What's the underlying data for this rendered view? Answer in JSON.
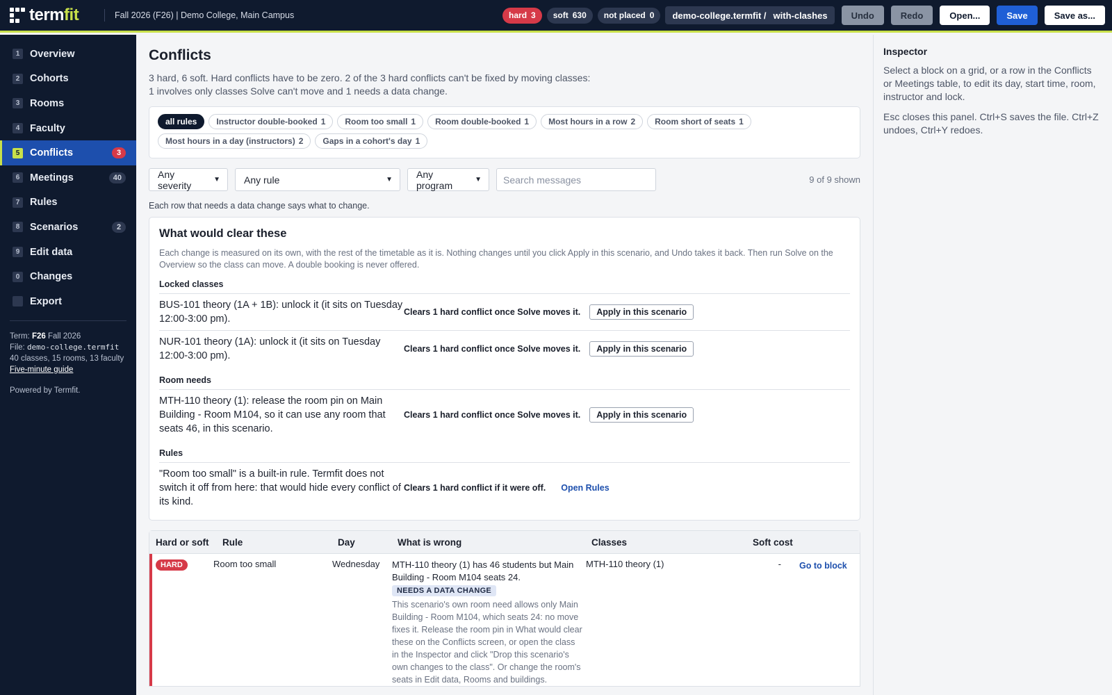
{
  "app": {
    "brand_a": "term",
    "brand_b": "fit",
    "term_label": "Fall 2026 (F26) | Demo College, Main Campus",
    "pills": {
      "hard_label": "hard",
      "hard_value": "3",
      "soft_label": "soft",
      "soft_value": "630",
      "unplaced_label": "not placed",
      "unplaced_value": "0"
    },
    "file_chip": {
      "file": "demo-college.termfit /",
      "scenario": "with-clashes"
    },
    "buttons": {
      "undo": "Undo",
      "redo": "Redo",
      "open": "Open...",
      "save": "Save",
      "save_as": "Save as..."
    }
  },
  "sidebar": {
    "items": [
      {
        "key": "1",
        "label": "Overview",
        "badge": ""
      },
      {
        "key": "2",
        "label": "Cohorts",
        "badge": ""
      },
      {
        "key": "3",
        "label": "Rooms",
        "badge": ""
      },
      {
        "key": "4",
        "label": "Faculty",
        "badge": ""
      },
      {
        "key": "5",
        "label": "Conflicts",
        "badge": "3"
      },
      {
        "key": "6",
        "label": "Meetings",
        "badge": "40"
      },
      {
        "key": "7",
        "label": "Rules",
        "badge": ""
      },
      {
        "key": "8",
        "label": "Scenarios",
        "badge": "2"
      },
      {
        "key": "9",
        "label": "Edit data",
        "badge": ""
      },
      {
        "key": "0",
        "label": "Changes",
        "badge": ""
      },
      {
        "key": "",
        "label": "Export",
        "badge": ""
      }
    ],
    "meta": {
      "term_prefix": "Term:",
      "term_code": "F26",
      "term_name": "Fall 2026",
      "file_prefix": "File:",
      "file_name": "demo-college.termfit",
      "counts": "40 classes, 15 rooms, 13 faculty",
      "guide_link": "Five-minute guide",
      "powered": "Powered by Termfit."
    }
  },
  "main": {
    "title": "Conflicts",
    "summary_line1": "3 hard, 6 soft. Hard conflicts have to be zero. 2 of the 3 hard conflicts can't be fixed by moving classes:",
    "summary_line2": "1 involves only classes Solve can't move and 1 needs a data change.",
    "rule_chips": [
      {
        "label": "all rules",
        "count": ""
      },
      {
        "label": "Instructor double-booked",
        "count": "1"
      },
      {
        "label": "Room too small",
        "count": "1"
      },
      {
        "label": "Room double-booked",
        "count": "1"
      },
      {
        "label": "Most hours in a row",
        "count": "2"
      },
      {
        "label": "Room short of seats",
        "count": "1"
      },
      {
        "label": "Most hours in a day (instructors)",
        "count": "2"
      },
      {
        "label": "Gaps in a cohort's day",
        "count": "1"
      }
    ],
    "filters": {
      "severity": "Any severity",
      "rule": "Any rule",
      "program": "Any program",
      "search_placeholder": "Search messages",
      "shown": "9 of 9 shown"
    },
    "hint": "Each row that needs a data change says what to change.",
    "clear_card": {
      "title": "What would clear these",
      "desc": "Each change is measured on its own, with the rest of the timetable as it is. Nothing changes until you click Apply in this scenario, and Undo takes it back. Then run Solve on the Overview so the class can move. A double booking is never offered.",
      "groups": [
        {
          "heading": "Locked classes",
          "rows": [
            {
              "text": "BUS-101 theory (1A + 1B): unlock it (it sits on Tuesday 12:00-3:00 pm).",
              "effect": "Clears 1 hard conflict once Solve moves it.",
              "action": "Apply in this scenario"
            },
            {
              "text": "NUR-101 theory (1A): unlock it (it sits on Tuesday 12:00-3:00 pm).",
              "effect": "Clears 1 hard conflict once Solve moves it.",
              "action": "Apply in this scenario"
            }
          ]
        },
        {
          "heading": "Room needs",
          "rows": [
            {
              "text": "MTH-110 theory (1): release the room pin on Main Building - Room M104, so it can use any room that seats 46, in this scenario.",
              "effect": "Clears 1 hard conflict once Solve moves it.",
              "action": "Apply in this scenario"
            }
          ]
        },
        {
          "heading": "Rules",
          "rows": [
            {
              "text": "\"Room too small\" is a built-in rule. Termfit does not switch it off from here: that would hide every conflict of its kind.",
              "effect": "Clears 1 hard conflict if it were off.",
              "action": "Open Rules"
            }
          ]
        }
      ]
    },
    "table": {
      "headers": [
        "Hard or soft",
        "Rule",
        "Day",
        "What is wrong",
        "Classes",
        "Soft cost"
      ],
      "rows": [
        {
          "severity": "HARD",
          "rule": "Room too small",
          "day": "Wednesday",
          "wrong": "MTH-110 theory (1) has 46 students but Main Building - Room M104 seats 24.",
          "tag": "NEEDS A DATA CHANGE",
          "detail": "This scenario's own room need allows only Main Building - Room M104, which seats 24: no move fixes it. Release the room pin in What would clear these on the Conflicts screen, or open the class in the Inspector and click \"Drop this scenario's own changes to the class\". Or change the room's seats in Edit data, Rooms and buildings.",
          "classes": "MTH-110 theory (1)",
          "cost": "-",
          "action": "Go to block"
        }
      ]
    }
  },
  "inspector": {
    "title": "Inspector",
    "p1": "Select a block on a grid, or a row in the Conflicts or Meetings table, to edit its day, start time, room, instructor and lock.",
    "p2": "Esc closes this panel. Ctrl+S saves the file. Ctrl+Z undoes, Ctrl+Y redoes."
  },
  "colors": {
    "nav_bg": "#0f1a2e",
    "accent": "#c8e04a",
    "active_nav": "#1d4fad",
    "hard": "#d63a48",
    "primary": "#1f5fd6",
    "link": "#1d4fad"
  },
  "icons": [
    "termfit-logo-icon",
    "chevron-down-icon"
  ]
}
